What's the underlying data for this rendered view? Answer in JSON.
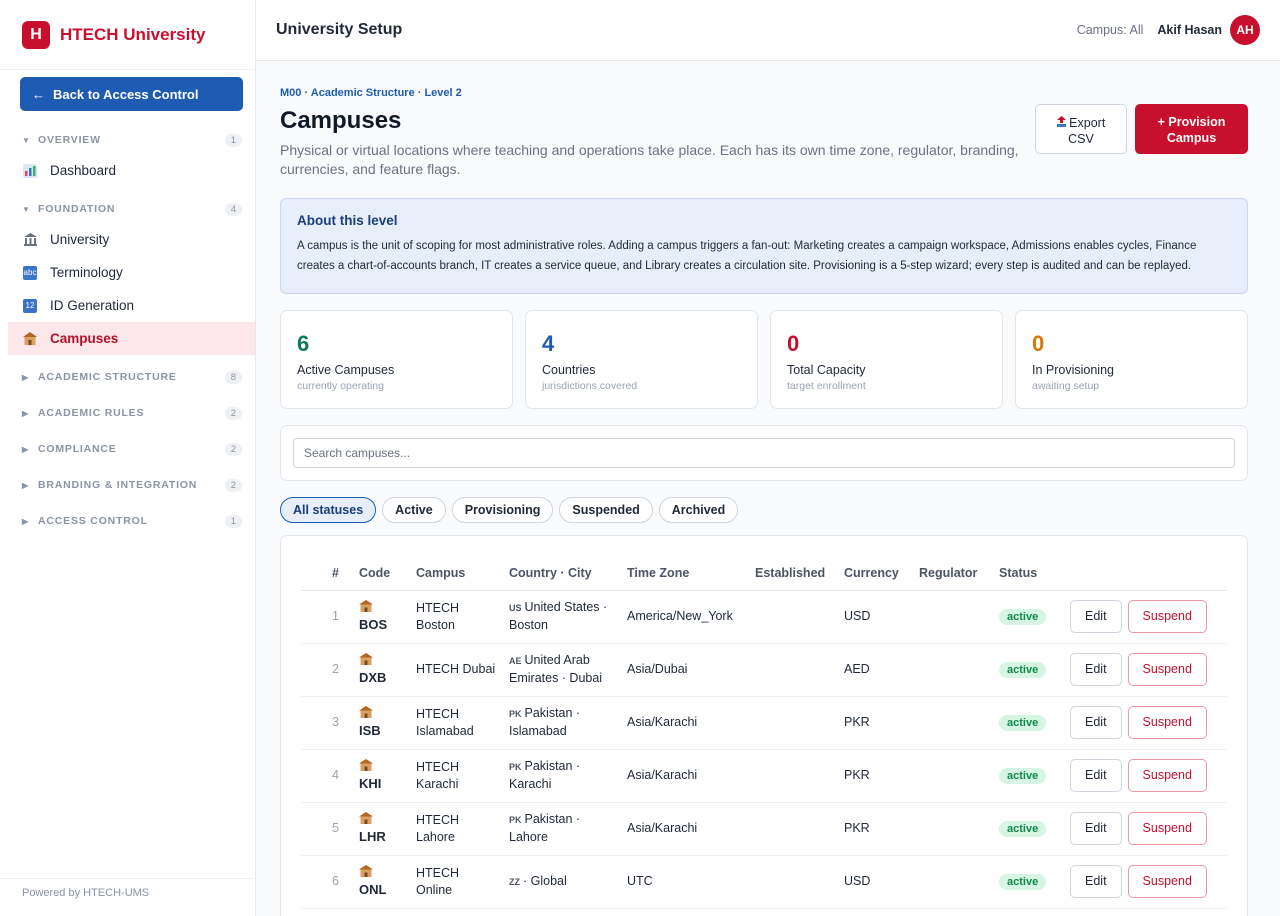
{
  "brand": {
    "logo_letter": "H",
    "name": "HTECH University"
  },
  "sidebar": {
    "back_label": "Back to Access Control",
    "back_arrow": "←",
    "groups": [
      {
        "label": "OVERVIEW",
        "count": "1",
        "expanded": true,
        "items": [
          {
            "label": "Dashboard",
            "icon": "chart-icon"
          }
        ]
      },
      {
        "label": "FOUNDATION",
        "count": "4",
        "expanded": true,
        "items": [
          {
            "label": "University",
            "icon": "building-icon"
          },
          {
            "label": "Terminology",
            "icon": "abc-icon"
          },
          {
            "label": "ID Generation",
            "icon": "numbers-icon"
          },
          {
            "label": "Campuses",
            "icon": "school-icon",
            "active": true
          }
        ]
      },
      {
        "label": "ACADEMIC STRUCTURE",
        "count": "8",
        "expanded": false
      },
      {
        "label": "ACADEMIC RULES",
        "count": "2",
        "expanded": false
      },
      {
        "label": "COMPLIANCE",
        "count": "2",
        "expanded": false
      },
      {
        "label": "BRANDING & INTEGRATION",
        "count": "2",
        "expanded": false
      },
      {
        "label": "ACCESS CONTROL",
        "count": "1",
        "expanded": false
      }
    ],
    "footer": "Powered by HTECH-UMS"
  },
  "topbar": {
    "title": "University Setup",
    "campus_filter": "Campus: All",
    "user_name": "Akif Hasan",
    "user_initials": "AH"
  },
  "page": {
    "breadcrumb": "M00 · Academic Structure · Level 2",
    "title": "Campuses",
    "description": "Physical or virtual locations where teaching and operations take place. Each has its own time zone, regulator, branding, currencies, and feature flags.",
    "export_label_line1": "Export",
    "export_label_line2": "CSV",
    "provision_label_line1": "+ Provision",
    "provision_label_line2": "Campus"
  },
  "about": {
    "title": "About this level",
    "text": "A campus is the unit of scoping for most administrative roles. Adding a campus triggers a fan-out: Marketing creates a campaign workspace, Admissions enables cycles, Finance creates a chart-of-accounts branch, IT creates a service queue, and Library creates a circulation site. Provisioning is a 5-step wizard; every step is audited and can be replayed."
  },
  "stats": [
    {
      "value": "6",
      "label": "Active Campuses",
      "sub": "currently operating",
      "color": "#0f7a55"
    },
    {
      "value": "4",
      "label": "Countries",
      "sub": "jurisdictions covered",
      "color": "#1e5cb3"
    },
    {
      "value": "0",
      "label": "Total Capacity",
      "sub": "target enrollment",
      "color": "#c8102e"
    },
    {
      "value": "0",
      "label": "In Provisioning",
      "sub": "awaiting setup",
      "color": "#d97706"
    }
  ],
  "search": {
    "placeholder": "Search campuses..."
  },
  "filters": [
    "All statuses",
    "Active",
    "Provisioning",
    "Suspended",
    "Archived"
  ],
  "table": {
    "headers": [
      "#",
      "Code",
      "Campus",
      "Country · City",
      "Time Zone",
      "Established",
      "Currency",
      "Regulator",
      "Status",
      ""
    ],
    "edit_label": "Edit",
    "suspend_label": "Suspend",
    "rows": [
      {
        "num": "1",
        "code": "BOS",
        "campus": "HTECH Boston",
        "flag": "US",
        "country_city": "United States · Boston",
        "tz": "America/New_York",
        "established": "",
        "currency": "USD",
        "regulator": "",
        "status": "active"
      },
      {
        "num": "2",
        "code": "DXB",
        "campus": "HTECH Dubai",
        "flag": "AE",
        "country_city": "United Arab Emirates · Dubai",
        "tz": "Asia/Dubai",
        "established": "",
        "currency": "AED",
        "regulator": "",
        "status": "active"
      },
      {
        "num": "3",
        "code": "ISB",
        "campus": "HTECH Islamabad",
        "flag": "PK",
        "country_city": "Pakistan · Islamabad",
        "tz": "Asia/Karachi",
        "established": "",
        "currency": "PKR",
        "regulator": "",
        "status": "active"
      },
      {
        "num": "4",
        "code": "KHI",
        "campus": "HTECH Karachi",
        "flag": "PK",
        "country_city": "Pakistan · Karachi",
        "tz": "Asia/Karachi",
        "established": "",
        "currency": "PKR",
        "regulator": "",
        "status": "active"
      },
      {
        "num": "5",
        "code": "LHR",
        "campus": "HTECH Lahore",
        "flag": "PK",
        "country_city": "Pakistan · Lahore",
        "tz": "Asia/Karachi",
        "established": "",
        "currency": "PKR",
        "regulator": "",
        "status": "active"
      },
      {
        "num": "6",
        "code": "ONL",
        "campus": "HTECH Online",
        "flag": "ZZ",
        "country_city": "· Global",
        "tz": "UTC",
        "established": "",
        "currency": "USD",
        "regulator": "",
        "status": "active"
      }
    ]
  }
}
